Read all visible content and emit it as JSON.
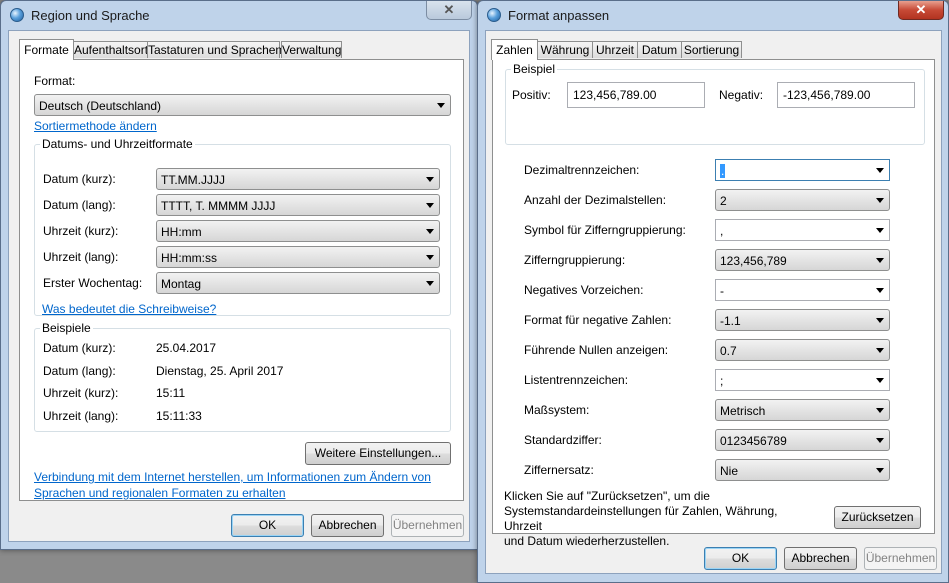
{
  "left_window": {
    "title": "Region und Sprache",
    "close_label": "✕",
    "tabs": [
      "Formate",
      "Aufenthaltsort",
      "Tastaturen und Sprachen",
      "Verwaltung"
    ],
    "format_label": "Format:",
    "format_value": "Deutsch (Deutschland)",
    "sort_link": "Sortiermethode ändern",
    "datetime_group": "Datums- und Uhrzeitformate",
    "rows": [
      {
        "label": "Datum (kurz):",
        "value": "TT.MM.JJJJ"
      },
      {
        "label": "Datum (lang):",
        "value": "TTTT, T. MMMM JJJJ"
      },
      {
        "label": "Uhrzeit (kurz):",
        "value": "HH:mm"
      },
      {
        "label": "Uhrzeit (lang):",
        "value": "HH:mm:ss"
      },
      {
        "label": "Erster Wochentag:",
        "value": "Montag"
      }
    ],
    "notation_link": "Was bedeutet die Schreibweise?",
    "examples_group": "Beispiele",
    "examples": [
      {
        "label": "Datum (kurz):",
        "value": "25.04.2017"
      },
      {
        "label": "Datum (lang):",
        "value": "Dienstag, 25. April 2017"
      },
      {
        "label": "Uhrzeit (kurz):",
        "value": "15:11"
      },
      {
        "label": "Uhrzeit (lang):",
        "value": "15:11:33"
      }
    ],
    "more_settings": "Weitere Einstellungen...",
    "internet_link_1": "Verbindung mit dem Internet herstellen, um Informationen zum Ändern von",
    "internet_link_2": "Sprachen und regionalen Formaten zu erhalten",
    "ok": "OK",
    "cancel": "Abbrechen",
    "apply": "Übernehmen"
  },
  "right_window": {
    "title": "Format anpassen",
    "close_label": "✕",
    "tabs": [
      "Zahlen",
      "Währung",
      "Uhrzeit",
      "Datum",
      "Sortierung"
    ],
    "example_group": "Beispiel",
    "positive_label": "Positiv:",
    "positive_value": "123,456,789.00",
    "negative_label": "Negativ:",
    "negative_value": "-123,456,789.00",
    "settings": [
      {
        "label": "Dezimaltrennzeichen:",
        "value": "."
      },
      {
        "label": "Anzahl der Dezimalstellen:",
        "value": "2"
      },
      {
        "label": "Symbol für Zifferngruppierung:",
        "value": ","
      },
      {
        "label": "Zifferngruppierung:",
        "value": "123,456,789"
      },
      {
        "label": "Negatives Vorzeichen:",
        "value": "-"
      },
      {
        "label": "Format für negative Zahlen:",
        "value": "-1.1"
      },
      {
        "label": "Führende Nullen anzeigen:",
        "value": "0.7"
      },
      {
        "label": "Listentrennzeichen:",
        "value": ";"
      },
      {
        "label": "Maßsystem:",
        "value": "Metrisch"
      },
      {
        "label": "Standardziffer:",
        "value": "0123456789"
      },
      {
        "label": "Ziffernersatz:",
        "value": "Nie"
      }
    ],
    "reset_text_1": "Klicken Sie auf \"Zurücksetzen\", um die",
    "reset_text_2": "Systemstandardeinstellungen für Zahlen, Währung, Uhrzeit",
    "reset_text_3": "und Datum wiederherzustellen.",
    "reset": "Zurücksetzen",
    "ok": "OK",
    "cancel": "Abbrechen",
    "apply": "Übernehmen"
  }
}
